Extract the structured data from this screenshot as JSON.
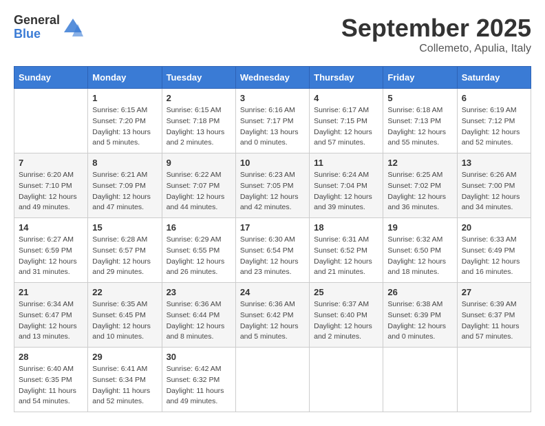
{
  "logo": {
    "general": "General",
    "blue": "Blue"
  },
  "title": "September 2025",
  "subtitle": "Collemeto, Apulia, Italy",
  "days_of_week": [
    "Sunday",
    "Monday",
    "Tuesday",
    "Wednesday",
    "Thursday",
    "Friday",
    "Saturday"
  ],
  "weeks": [
    [
      {
        "day": "",
        "info": ""
      },
      {
        "day": "1",
        "info": "Sunrise: 6:15 AM\nSunset: 7:20 PM\nDaylight: 13 hours\nand 5 minutes."
      },
      {
        "day": "2",
        "info": "Sunrise: 6:15 AM\nSunset: 7:18 PM\nDaylight: 13 hours\nand 2 minutes."
      },
      {
        "day": "3",
        "info": "Sunrise: 6:16 AM\nSunset: 7:17 PM\nDaylight: 13 hours\nand 0 minutes."
      },
      {
        "day": "4",
        "info": "Sunrise: 6:17 AM\nSunset: 7:15 PM\nDaylight: 12 hours\nand 57 minutes."
      },
      {
        "day": "5",
        "info": "Sunrise: 6:18 AM\nSunset: 7:13 PM\nDaylight: 12 hours\nand 55 minutes."
      },
      {
        "day": "6",
        "info": "Sunrise: 6:19 AM\nSunset: 7:12 PM\nDaylight: 12 hours\nand 52 minutes."
      }
    ],
    [
      {
        "day": "7",
        "info": "Sunrise: 6:20 AM\nSunset: 7:10 PM\nDaylight: 12 hours\nand 49 minutes."
      },
      {
        "day": "8",
        "info": "Sunrise: 6:21 AM\nSunset: 7:09 PM\nDaylight: 12 hours\nand 47 minutes."
      },
      {
        "day": "9",
        "info": "Sunrise: 6:22 AM\nSunset: 7:07 PM\nDaylight: 12 hours\nand 44 minutes."
      },
      {
        "day": "10",
        "info": "Sunrise: 6:23 AM\nSunset: 7:05 PM\nDaylight: 12 hours\nand 42 minutes."
      },
      {
        "day": "11",
        "info": "Sunrise: 6:24 AM\nSunset: 7:04 PM\nDaylight: 12 hours\nand 39 minutes."
      },
      {
        "day": "12",
        "info": "Sunrise: 6:25 AM\nSunset: 7:02 PM\nDaylight: 12 hours\nand 36 minutes."
      },
      {
        "day": "13",
        "info": "Sunrise: 6:26 AM\nSunset: 7:00 PM\nDaylight: 12 hours\nand 34 minutes."
      }
    ],
    [
      {
        "day": "14",
        "info": "Sunrise: 6:27 AM\nSunset: 6:59 PM\nDaylight: 12 hours\nand 31 minutes."
      },
      {
        "day": "15",
        "info": "Sunrise: 6:28 AM\nSunset: 6:57 PM\nDaylight: 12 hours\nand 29 minutes."
      },
      {
        "day": "16",
        "info": "Sunrise: 6:29 AM\nSunset: 6:55 PM\nDaylight: 12 hours\nand 26 minutes."
      },
      {
        "day": "17",
        "info": "Sunrise: 6:30 AM\nSunset: 6:54 PM\nDaylight: 12 hours\nand 23 minutes."
      },
      {
        "day": "18",
        "info": "Sunrise: 6:31 AM\nSunset: 6:52 PM\nDaylight: 12 hours\nand 21 minutes."
      },
      {
        "day": "19",
        "info": "Sunrise: 6:32 AM\nSunset: 6:50 PM\nDaylight: 12 hours\nand 18 minutes."
      },
      {
        "day": "20",
        "info": "Sunrise: 6:33 AM\nSunset: 6:49 PM\nDaylight: 12 hours\nand 16 minutes."
      }
    ],
    [
      {
        "day": "21",
        "info": "Sunrise: 6:34 AM\nSunset: 6:47 PM\nDaylight: 12 hours\nand 13 minutes."
      },
      {
        "day": "22",
        "info": "Sunrise: 6:35 AM\nSunset: 6:45 PM\nDaylight: 12 hours\nand 10 minutes."
      },
      {
        "day": "23",
        "info": "Sunrise: 6:36 AM\nSunset: 6:44 PM\nDaylight: 12 hours\nand 8 minutes."
      },
      {
        "day": "24",
        "info": "Sunrise: 6:36 AM\nSunset: 6:42 PM\nDaylight: 12 hours\nand 5 minutes."
      },
      {
        "day": "25",
        "info": "Sunrise: 6:37 AM\nSunset: 6:40 PM\nDaylight: 12 hours\nand 2 minutes."
      },
      {
        "day": "26",
        "info": "Sunrise: 6:38 AM\nSunset: 6:39 PM\nDaylight: 12 hours\nand 0 minutes."
      },
      {
        "day": "27",
        "info": "Sunrise: 6:39 AM\nSunset: 6:37 PM\nDaylight: 11 hours\nand 57 minutes."
      }
    ],
    [
      {
        "day": "28",
        "info": "Sunrise: 6:40 AM\nSunset: 6:35 PM\nDaylight: 11 hours\nand 54 minutes."
      },
      {
        "day": "29",
        "info": "Sunrise: 6:41 AM\nSunset: 6:34 PM\nDaylight: 11 hours\nand 52 minutes."
      },
      {
        "day": "30",
        "info": "Sunrise: 6:42 AM\nSunset: 6:32 PM\nDaylight: 11 hours\nand 49 minutes."
      },
      {
        "day": "",
        "info": ""
      },
      {
        "day": "",
        "info": ""
      },
      {
        "day": "",
        "info": ""
      },
      {
        "day": "",
        "info": ""
      }
    ]
  ]
}
